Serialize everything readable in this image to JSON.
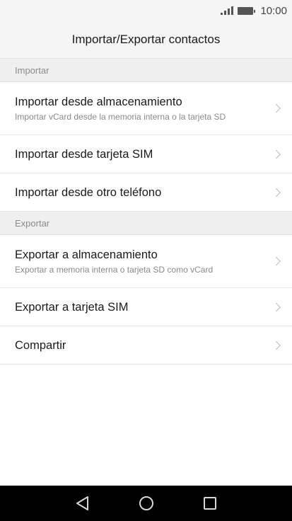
{
  "status_bar": {
    "time": "10:00",
    "icons": [
      "signal-icon",
      "battery-icon"
    ]
  },
  "header": {
    "title": "Importar/Exportar contactos"
  },
  "sections": [
    {
      "header": "Importar",
      "items": [
        {
          "title": "Importar desde almacenamiento",
          "subtitle": "Importar vCard desde la memoria interna o la tarjeta SD"
        },
        {
          "title": "Importar desde tarjeta SIM"
        },
        {
          "title": "Importar desde otro teléfono"
        }
      ]
    },
    {
      "header": "Exportar",
      "items": [
        {
          "title": "Exportar a almacenamiento",
          "subtitle": "Exportar a memoria interna o tarjeta SD como vCard"
        },
        {
          "title": "Exportar a tarjeta SIM"
        },
        {
          "title": "Compartir"
        }
      ]
    }
  ],
  "nav_bar": {
    "icons": [
      "back-icon",
      "home-icon",
      "recents-icon"
    ]
  }
}
